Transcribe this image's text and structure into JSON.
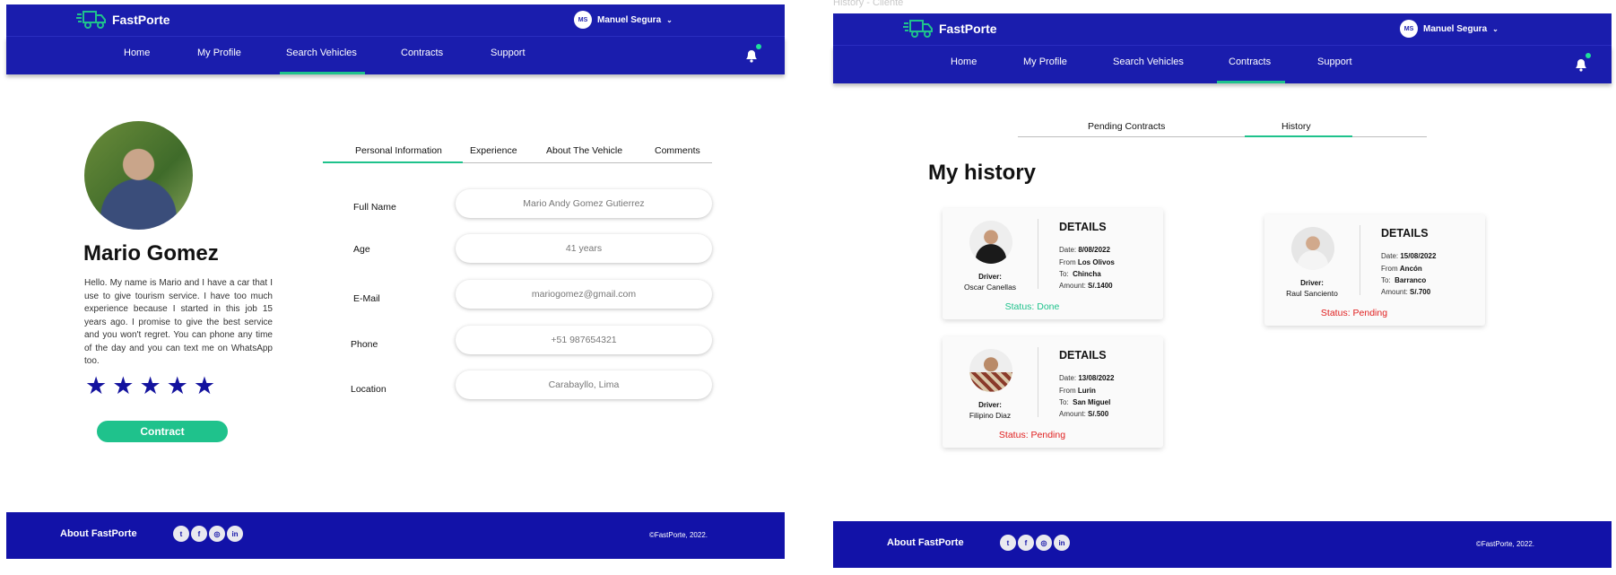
{
  "caption": "History - Cliente",
  "brand": {
    "name": "FastPorte",
    "accent": "#1fc28c",
    "primary": "#1a1dad",
    "logo_icon": "truck-icon"
  },
  "user": {
    "initials": "MS",
    "name": "Manuel Segura"
  },
  "nav_left": {
    "items": [
      "Home",
      "My Profile",
      "Search Vehicles",
      "Contracts",
      "Support"
    ],
    "active": "Search Vehicles"
  },
  "nav_right": {
    "items": [
      "Home",
      "My Profile",
      "Search Vehicles",
      "Contracts",
      "Support"
    ],
    "active": "Contracts"
  },
  "profile": {
    "name": "Mario Gomez",
    "bio": "Hello. My name is Mario and I have a car that I use to give tourism service. I have too much experience because I started in this job 15 years ago. I promise to give the best service and you won't regret. You can phone any time of the day and you can text me on WhatsApp too.",
    "rating": 5,
    "contract_button": "Contract",
    "tabs": [
      "Personal Information",
      "Experience",
      "About The Vehicle",
      "Comments"
    ],
    "active_tab": "Personal Information",
    "fields": [
      {
        "label": "Full Name",
        "value": "Mario Andy Gomez Gutierrez"
      },
      {
        "label": "Age",
        "value": "41 years"
      },
      {
        "label": "E-Mail",
        "value": "mariogomez@gmail.com"
      },
      {
        "label": "Phone",
        "value": "+51 987654321"
      },
      {
        "label": "Location",
        "value": "Carabayllo, Lima"
      }
    ]
  },
  "history": {
    "tabs": [
      "Pending Contracts",
      "History"
    ],
    "active_tab": "History",
    "heading": "My history",
    "details_title": "DETAILS",
    "driver_label": "Driver:",
    "date_label": "Date:",
    "from_label": "From",
    "to_label": "To:",
    "amount_label": "Amount:",
    "cards": [
      {
        "driver": "Oscar Canellas",
        "date": "8/08/2022",
        "from": "Los Olivos",
        "to": "Chincha",
        "amount": "S/.1400",
        "status": "Status: Done"
      },
      {
        "driver": "Raul Sanciento",
        "date": "15/08/2022",
        "from": "Ancón",
        "to": "Barranco",
        "amount": "S/.700",
        "status": "Status: Pending"
      },
      {
        "driver": "Filipino Diaz",
        "date": "13/08/2022",
        "from": "Lurin",
        "to": "San Miguel",
        "amount": "S/.500",
        "status": "Status: Pending"
      }
    ]
  },
  "footer": {
    "about": "About FastPorte",
    "copyright": "©FastPorte, 2022.",
    "socials": [
      "twitter-icon",
      "facebook-icon",
      "instagram-icon",
      "linkedin-icon"
    ]
  }
}
